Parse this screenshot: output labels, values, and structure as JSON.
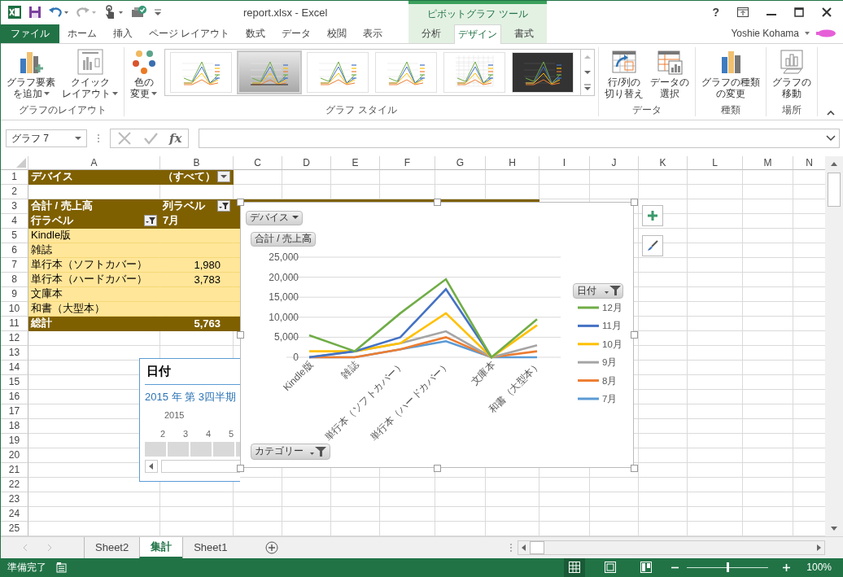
{
  "window": {
    "title": "report.xlsx - Excel",
    "context_group": "ピボットグラフ ツール",
    "help": "?",
    "user": "Yoshie Kohama"
  },
  "ribbon_tabs": [
    {
      "label": "ファイル",
      "kind": "file",
      "selected": false
    },
    {
      "label": "ホーム",
      "kind": "normal",
      "selected": false
    },
    {
      "label": "挿入",
      "kind": "normal",
      "selected": false
    },
    {
      "label": "ページ レイアウト",
      "kind": "normal",
      "selected": false
    },
    {
      "label": "数式",
      "kind": "normal",
      "selected": false
    },
    {
      "label": "データ",
      "kind": "normal",
      "selected": false
    },
    {
      "label": "校閲",
      "kind": "normal",
      "selected": false
    },
    {
      "label": "表示",
      "kind": "normal",
      "selected": false
    },
    {
      "label": "分析",
      "kind": "context",
      "selected": false
    },
    {
      "label": "デザイン",
      "kind": "context",
      "selected": true
    },
    {
      "label": "書式",
      "kind": "context",
      "selected": false
    }
  ],
  "ribbon_groups": [
    {
      "label": "グラフのレイアウト",
      "buttons": [
        {
          "lines": [
            "グラフ要素",
            "を追加"
          ],
          "kind": "add-element",
          "dropdown": true
        },
        {
          "lines": [
            "クイック",
            "レイアウト"
          ],
          "kind": "quick-layout",
          "dropdown": true
        }
      ]
    },
    {
      "label": "グラフ スタイル",
      "buttons": [
        {
          "lines": [
            "色の",
            "変更"
          ],
          "kind": "colors",
          "dropdown": true
        }
      ],
      "styles": [
        {
          "kind": "plain",
          "selected": false
        },
        {
          "kind": "shaded",
          "selected": true
        },
        {
          "kind": "plain",
          "selected": false
        },
        {
          "kind": "plain",
          "selected": false
        },
        {
          "kind": "grid",
          "selected": false
        },
        {
          "kind": "dark",
          "selected": false
        }
      ]
    },
    {
      "label": "データ",
      "buttons": [
        {
          "lines": [
            "行/列の",
            "切り替え"
          ],
          "kind": "switch",
          "dropdown": false
        },
        {
          "lines": [
            "データの",
            "選択"
          ],
          "kind": "select-data",
          "dropdown": false
        }
      ]
    },
    {
      "label": "種類",
      "buttons": [
        {
          "lines": [
            "グラフの種類",
            "の変更"
          ],
          "kind": "chart-type",
          "dropdown": false
        }
      ]
    },
    {
      "label": "場所",
      "buttons": [
        {
          "lines": [
            "グラフの",
            "移動"
          ],
          "kind": "move",
          "dropdown": false
        }
      ]
    }
  ],
  "formula_bar": {
    "name_box": "グラフ 7",
    "function_label": "fx"
  },
  "sheet": {
    "columns": [
      "A",
      "B",
      "C",
      "D",
      "E",
      "F",
      "G",
      "H",
      "I",
      "J",
      "K",
      "L",
      "M",
      "N"
    ],
    "row_numbers": [
      "1",
      "2",
      "3",
      "4",
      "5",
      "6",
      "7",
      "8",
      "9",
      "10",
      "11",
      "12",
      "13",
      "14",
      "15",
      "16",
      "17",
      "18",
      "19",
      "20",
      "21",
      "22",
      "23",
      "24",
      "25"
    ],
    "pivot": [
      {
        "kind": "filter",
        "label": "デバイス",
        "value": "（すべて）"
      },
      {
        "kind": "blank"
      },
      {
        "kind": "head",
        "label": "合計 / 売上高",
        "value": "列ラベル",
        "value_button": true
      },
      {
        "kind": "head",
        "label": "行ラベル",
        "value": "7月",
        "label_button": true
      },
      {
        "kind": "data",
        "label": "Kindle版"
      },
      {
        "kind": "data",
        "label": "雑誌"
      },
      {
        "kind": "data",
        "label": "単行本（ソフトカバー）",
        "value": "1,980"
      },
      {
        "kind": "data",
        "label": "単行本（ハードカバー）",
        "value": "3,783"
      },
      {
        "kind": "data",
        "label": "文庫本"
      },
      {
        "kind": "data",
        "label": "和書（大型本）"
      },
      {
        "kind": "total",
        "label": "総計",
        "value": "5,763"
      }
    ]
  },
  "timeline": {
    "title": "日付",
    "period": "2015 年 第 3四半期",
    "year": "2015",
    "months": [
      "2",
      "3",
      "4",
      "5"
    ]
  },
  "chart": {
    "filter_button": "デバイス",
    "value_button": "合計 / 売上高",
    "axis_button": "カテゴリー",
    "legend_button": "日付",
    "chart_data": {
      "type": "line",
      "categories": [
        "Kindle版",
        "雑誌",
        "単行本（ソフトカバー）",
        "単行本（ハードカバー）",
        "文庫本",
        "和書（大型本）"
      ],
      "ylim": [
        0,
        25000
      ],
      "grid": true,
      "legend": "right",
      "yticks": [
        {
          "value": 0,
          "label": "0"
        },
        {
          "value": 5000,
          "label": "5,000"
        },
        {
          "value": 10000,
          "label": "10,000"
        },
        {
          "value": 15000,
          "label": "15,000"
        },
        {
          "value": 20000,
          "label": "20,000"
        },
        {
          "value": 25000,
          "label": "25,000"
        }
      ],
      "series": [
        {
          "name": "12月",
          "color": "#70ad47",
          "values": [
            5500,
            1500,
            11000,
            19500,
            0,
            9500
          ]
        },
        {
          "name": "11月",
          "color": "#4472c4",
          "values": [
            0,
            1500,
            5000,
            17000,
            0,
            null
          ]
        },
        {
          "name": "10月",
          "color": "#ffc000",
          "values": [
            1500,
            1500,
            3500,
            11000,
            0,
            8000
          ]
        },
        {
          "name": "9月",
          "color": "#a5a5a5",
          "values": [
            0,
            1500,
            3500,
            6500,
            0,
            3000
          ]
        },
        {
          "name": "8月",
          "color": "#ed7d31",
          "values": [
            0,
            0,
            2000,
            5000,
            0,
            1500
          ]
        },
        {
          "name": "7月",
          "color": "#5b9bd5",
          "values": [
            0,
            0,
            2000,
            4000,
            0,
            0
          ]
        }
      ]
    }
  },
  "sheet_tabs": [
    {
      "label": "Sheet2",
      "selected": false
    },
    {
      "label": "集計",
      "selected": true
    },
    {
      "label": "Sheet1",
      "selected": false
    }
  ],
  "status_bar": {
    "text": "準備完了",
    "views": [
      {
        "kind": "normal",
        "selected": true
      },
      {
        "kind": "page-layout",
        "selected": false
      },
      {
        "kind": "page-break",
        "selected": false
      }
    ],
    "zoom_slider": {
      "level": 0.5
    },
    "zoom": "100%"
  }
}
